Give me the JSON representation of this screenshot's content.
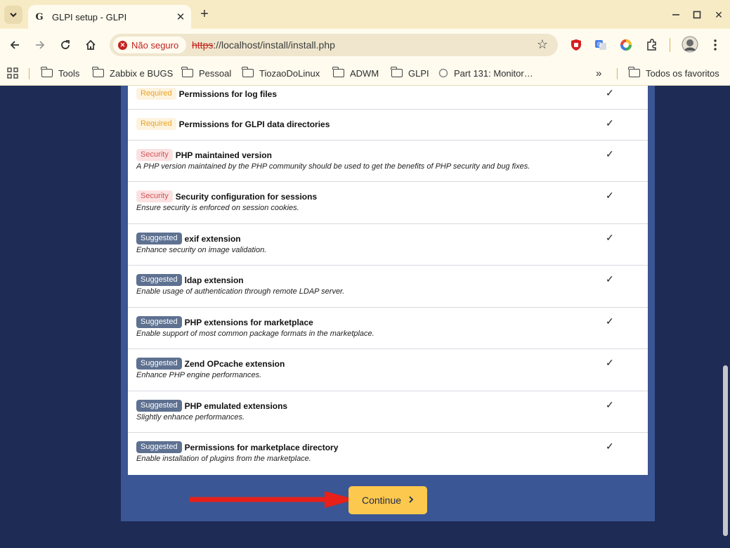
{
  "browser": {
    "tab_title": "GLPI setup - GLPI",
    "favicon": "G",
    "security_label": "Não seguro",
    "url_scheme": "https",
    "url_rest": "://localhost/install/install.php",
    "bookmarks": [
      {
        "label": "Tools"
      },
      {
        "label": "Zabbix e BUGS"
      },
      {
        "label": "Pessoal"
      },
      {
        "label": "TiozaoDoLinux"
      },
      {
        "label": "ADWM"
      },
      {
        "label": "GLPI"
      },
      {
        "label": "Part 131: Monitor…"
      }
    ],
    "all_bookmarks": "Todos os favoritos"
  },
  "checks": [
    {
      "badge": "Required",
      "title": "Permissions for log files",
      "desc": "",
      "status": "✓"
    },
    {
      "badge": "Required",
      "title": "Permissions for GLPI data directories",
      "desc": "",
      "status": "✓"
    },
    {
      "badge": "Security",
      "title": "PHP maintained version",
      "desc": "A PHP version maintained by the PHP community should be used to get the benefits of PHP security and bug fixes.",
      "status": "✓"
    },
    {
      "badge": "Security",
      "title": "Security configuration for sessions",
      "desc": "Ensure security is enforced on session cookies.",
      "status": "✓"
    },
    {
      "badge": "Suggested",
      "title": "exif extension",
      "desc": "Enhance security on image validation.",
      "status": "✓"
    },
    {
      "badge": "Suggested",
      "title": "ldap extension",
      "desc": "Enable usage of authentication through remote LDAP server.",
      "status": "✓"
    },
    {
      "badge": "Suggested",
      "title": "PHP extensions for marketplace",
      "desc": "Enable support of most common package formats in the marketplace.",
      "status": "✓"
    },
    {
      "badge": "Suggested",
      "title": "Zend OPcache extension",
      "desc": "Enhance PHP engine performances.",
      "status": "✓"
    },
    {
      "badge": "Suggested",
      "title": "PHP emulated extensions",
      "desc": "Slightly enhance performances.",
      "status": "✓"
    },
    {
      "badge": "Suggested",
      "title": "Permissions for marketplace directory",
      "desc": "Enable installation of plugins from the marketplace.",
      "status": "✓"
    }
  ],
  "continue_label": "Continue",
  "colors": {
    "page_bg": "#1e2b55",
    "card_bg": "#3b5694",
    "button_bg": "#fcc84d",
    "arrow": "#e8201a"
  }
}
